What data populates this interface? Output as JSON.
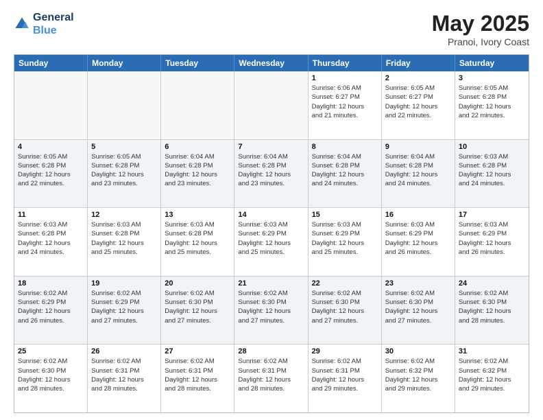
{
  "logo": {
    "line1": "General",
    "line2": "Blue"
  },
  "title": "May 2025",
  "subtitle": "Pranoi, Ivory Coast",
  "days": [
    "Sunday",
    "Monday",
    "Tuesday",
    "Wednesday",
    "Thursday",
    "Friday",
    "Saturday"
  ],
  "rows": [
    [
      {
        "day": "",
        "info": "",
        "empty": true
      },
      {
        "day": "",
        "info": "",
        "empty": true
      },
      {
        "day": "",
        "info": "",
        "empty": true
      },
      {
        "day": "",
        "info": "",
        "empty": true
      },
      {
        "day": "1",
        "info": "Sunrise: 6:06 AM\nSunset: 6:27 PM\nDaylight: 12 hours\nand 21 minutes."
      },
      {
        "day": "2",
        "info": "Sunrise: 6:05 AM\nSunset: 6:27 PM\nDaylight: 12 hours\nand 22 minutes."
      },
      {
        "day": "3",
        "info": "Sunrise: 6:05 AM\nSunset: 6:28 PM\nDaylight: 12 hours\nand 22 minutes."
      }
    ],
    [
      {
        "day": "4",
        "info": "Sunrise: 6:05 AM\nSunset: 6:28 PM\nDaylight: 12 hours\nand 22 minutes."
      },
      {
        "day": "5",
        "info": "Sunrise: 6:05 AM\nSunset: 6:28 PM\nDaylight: 12 hours\nand 23 minutes."
      },
      {
        "day": "6",
        "info": "Sunrise: 6:04 AM\nSunset: 6:28 PM\nDaylight: 12 hours\nand 23 minutes."
      },
      {
        "day": "7",
        "info": "Sunrise: 6:04 AM\nSunset: 6:28 PM\nDaylight: 12 hours\nand 23 minutes."
      },
      {
        "day": "8",
        "info": "Sunrise: 6:04 AM\nSunset: 6:28 PM\nDaylight: 12 hours\nand 24 minutes."
      },
      {
        "day": "9",
        "info": "Sunrise: 6:04 AM\nSunset: 6:28 PM\nDaylight: 12 hours\nand 24 minutes."
      },
      {
        "day": "10",
        "info": "Sunrise: 6:03 AM\nSunset: 6:28 PM\nDaylight: 12 hours\nand 24 minutes."
      }
    ],
    [
      {
        "day": "11",
        "info": "Sunrise: 6:03 AM\nSunset: 6:28 PM\nDaylight: 12 hours\nand 24 minutes."
      },
      {
        "day": "12",
        "info": "Sunrise: 6:03 AM\nSunset: 6:28 PM\nDaylight: 12 hours\nand 25 minutes."
      },
      {
        "day": "13",
        "info": "Sunrise: 6:03 AM\nSunset: 6:28 PM\nDaylight: 12 hours\nand 25 minutes."
      },
      {
        "day": "14",
        "info": "Sunrise: 6:03 AM\nSunset: 6:29 PM\nDaylight: 12 hours\nand 25 minutes."
      },
      {
        "day": "15",
        "info": "Sunrise: 6:03 AM\nSunset: 6:29 PM\nDaylight: 12 hours\nand 25 minutes."
      },
      {
        "day": "16",
        "info": "Sunrise: 6:03 AM\nSunset: 6:29 PM\nDaylight: 12 hours\nand 26 minutes."
      },
      {
        "day": "17",
        "info": "Sunrise: 6:03 AM\nSunset: 6:29 PM\nDaylight: 12 hours\nand 26 minutes."
      }
    ],
    [
      {
        "day": "18",
        "info": "Sunrise: 6:02 AM\nSunset: 6:29 PM\nDaylight: 12 hours\nand 26 minutes."
      },
      {
        "day": "19",
        "info": "Sunrise: 6:02 AM\nSunset: 6:29 PM\nDaylight: 12 hours\nand 27 minutes."
      },
      {
        "day": "20",
        "info": "Sunrise: 6:02 AM\nSunset: 6:30 PM\nDaylight: 12 hours\nand 27 minutes."
      },
      {
        "day": "21",
        "info": "Sunrise: 6:02 AM\nSunset: 6:30 PM\nDaylight: 12 hours\nand 27 minutes."
      },
      {
        "day": "22",
        "info": "Sunrise: 6:02 AM\nSunset: 6:30 PM\nDaylight: 12 hours\nand 27 minutes."
      },
      {
        "day": "23",
        "info": "Sunrise: 6:02 AM\nSunset: 6:30 PM\nDaylight: 12 hours\nand 27 minutes."
      },
      {
        "day": "24",
        "info": "Sunrise: 6:02 AM\nSunset: 6:30 PM\nDaylight: 12 hours\nand 28 minutes."
      }
    ],
    [
      {
        "day": "25",
        "info": "Sunrise: 6:02 AM\nSunset: 6:30 PM\nDaylight: 12 hours\nand 28 minutes."
      },
      {
        "day": "26",
        "info": "Sunrise: 6:02 AM\nSunset: 6:31 PM\nDaylight: 12 hours\nand 28 minutes."
      },
      {
        "day": "27",
        "info": "Sunrise: 6:02 AM\nSunset: 6:31 PM\nDaylight: 12 hours\nand 28 minutes."
      },
      {
        "day": "28",
        "info": "Sunrise: 6:02 AM\nSunset: 6:31 PM\nDaylight: 12 hours\nand 28 minutes."
      },
      {
        "day": "29",
        "info": "Sunrise: 6:02 AM\nSunset: 6:31 PM\nDaylight: 12 hours\nand 29 minutes."
      },
      {
        "day": "30",
        "info": "Sunrise: 6:02 AM\nSunset: 6:32 PM\nDaylight: 12 hours\nand 29 minutes."
      },
      {
        "day": "31",
        "info": "Sunrise: 6:02 AM\nSunset: 6:32 PM\nDaylight: 12 hours\nand 29 minutes."
      }
    ]
  ]
}
